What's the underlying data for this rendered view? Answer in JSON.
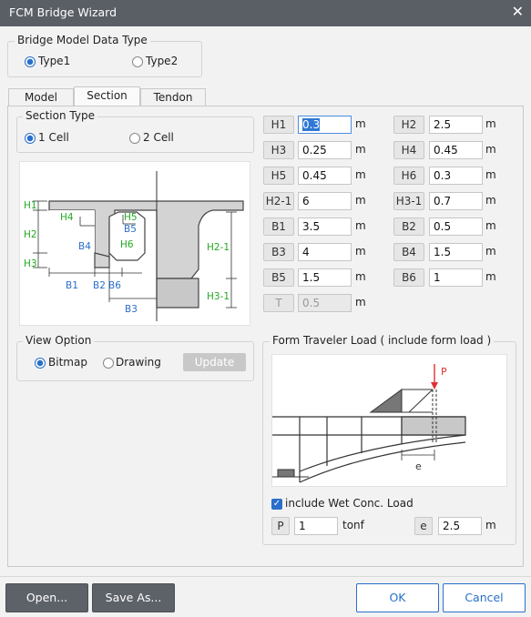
{
  "window": {
    "title": "FCM Bridge Wizard",
    "close_glyph": "✕"
  },
  "model_type": {
    "legend": "Bridge Model Data Type",
    "options": [
      "Type1",
      "Type2"
    ],
    "selected": "Type1"
  },
  "tabs": [
    "Model",
    "Section",
    "Tendon"
  ],
  "active_tab": "Section",
  "section_type": {
    "legend": "Section Type",
    "options": [
      "1 Cell",
      "2 Cell"
    ],
    "selected": "1 Cell"
  },
  "diagram_labels": {
    "H1": "H1",
    "H2": "H2",
    "H3": "H3",
    "H4": "H4",
    "H5": "H5",
    "H6": "H6",
    "H2_1": "H2-1",
    "H3_1": "H3-1",
    "B1": "B1",
    "B2": "B2",
    "B3": "B3",
    "B4": "B4",
    "B5": "B5",
    "B6": "B6"
  },
  "params_left": [
    {
      "label": "H1",
      "value": "0.3",
      "unit": "m"
    },
    {
      "label": "H3",
      "value": "0.25",
      "unit": "m"
    },
    {
      "label": "H5",
      "value": "0.45",
      "unit": "m"
    },
    {
      "label": "H2-1",
      "value": "6",
      "unit": "m"
    },
    {
      "label": "B1",
      "value": "3.5",
      "unit": "m"
    },
    {
      "label": "B3",
      "value": "4",
      "unit": "m"
    },
    {
      "label": "B5",
      "value": "1.5",
      "unit": "m"
    },
    {
      "label": "T",
      "value": "0.5",
      "unit": "m"
    }
  ],
  "params_right": [
    {
      "label": "H2",
      "value": "2.5",
      "unit": "m"
    },
    {
      "label": "H4",
      "value": "0.45",
      "unit": "m"
    },
    {
      "label": "H6",
      "value": "0.3",
      "unit": "m"
    },
    {
      "label": "H3-1",
      "value": "0.7",
      "unit": "m"
    },
    {
      "label": "B2",
      "value": "0.5",
      "unit": "m"
    },
    {
      "label": "B4",
      "value": "1.5",
      "unit": "m"
    },
    {
      "label": "B6",
      "value": "1",
      "unit": "m"
    }
  ],
  "view_option": {
    "legend": "View Option",
    "options": [
      "Bitmap",
      "Drawing"
    ],
    "selected": "Bitmap",
    "update_label": "Update"
  },
  "form_traveler": {
    "legend": "Form Traveler Load ( include form load )",
    "diagram_p": "P",
    "diagram_e": "e",
    "include_wet_label": "include Wet Conc. Load",
    "include_wet_checked": true,
    "P": {
      "label": "P",
      "value": "1",
      "unit": "tonf"
    },
    "e": {
      "label": "e",
      "value": "2.5",
      "unit": "m"
    }
  },
  "buttons": {
    "open": "Open...",
    "save_as": "Save As...",
    "ok": "OK",
    "cancel": "Cancel"
  },
  "colors": {
    "titlebar": "#5a5f66",
    "accent": "#2a6fc9",
    "label_green": "#22aa22",
    "label_blue": "#2a6fc9",
    "load_red": "#e03030"
  }
}
